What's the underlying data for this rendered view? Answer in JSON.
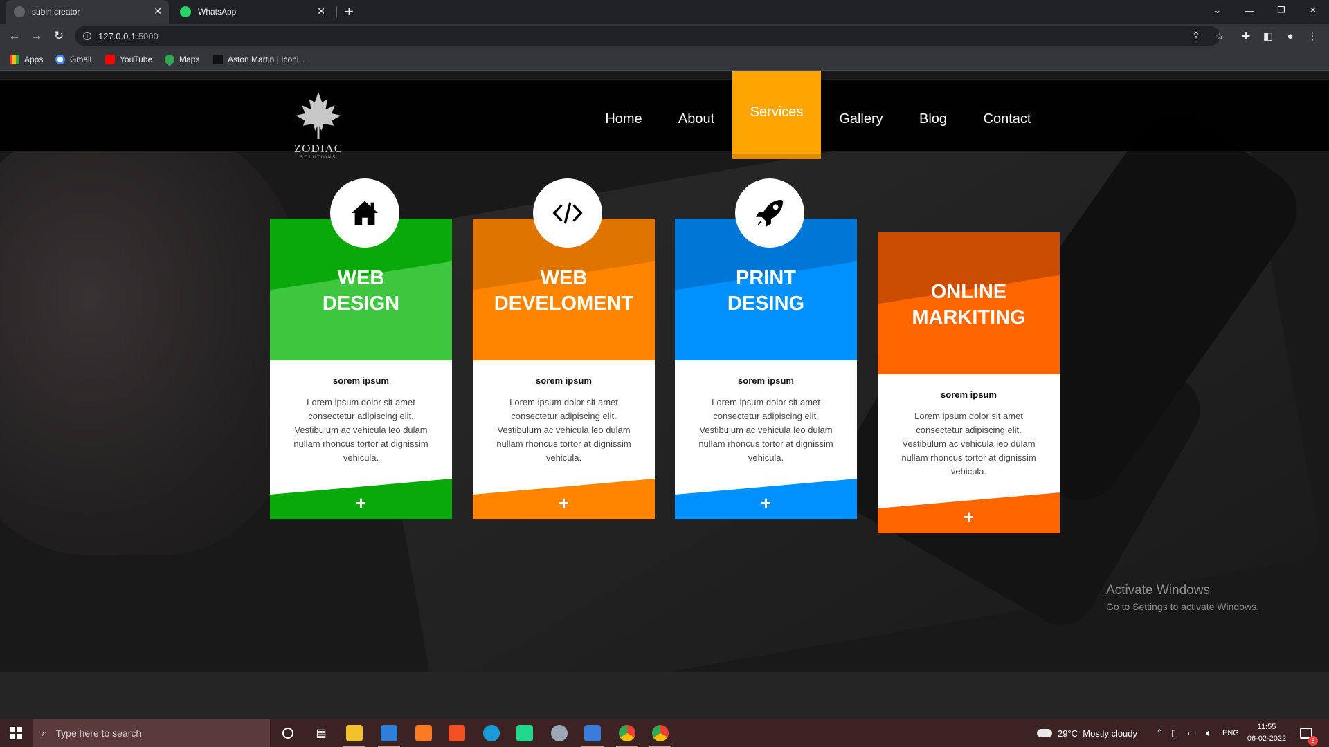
{
  "browser": {
    "tabs": [
      {
        "title": "subin creator",
        "active": true
      },
      {
        "title": "WhatsApp",
        "active": false
      }
    ],
    "url_host": "127.0.0.1",
    "url_port": ":5000",
    "bookmarks": [
      {
        "label": "Apps",
        "icon": "apps-grid-icon"
      },
      {
        "label": "Gmail",
        "icon": "google-icon"
      },
      {
        "label": "YouTube",
        "icon": "youtube-icon"
      },
      {
        "label": "Maps",
        "icon": "maps-pin-icon"
      },
      {
        "label": "Aston Martin | Iconi...",
        "icon": "aston-martin-icon"
      }
    ]
  },
  "site": {
    "logo": {
      "name": "ZODIAC",
      "sub": "SOLUTIONS"
    },
    "nav": [
      {
        "label": "Home",
        "active": false
      },
      {
        "label": "About",
        "active": false
      },
      {
        "label": "Services",
        "active": true
      },
      {
        "label": "Gallery",
        "active": false
      },
      {
        "label": "Blog",
        "active": false
      },
      {
        "label": "Contact",
        "active": false
      }
    ],
    "cards": [
      {
        "title1": "WEB",
        "title2": "DESIGN",
        "subtitle": "sorem ipsum",
        "description": "Lorem ipsum dolor sit amet consectetur adipiscing elit. Vestibulum ac vehicula leo dulam nullam rhoncus tortor at dignissim vehicula.",
        "plus": "+",
        "icon": "home-icon",
        "color": "#0aa90a",
        "color_light": "#3fc63f"
      },
      {
        "title1": "WEB",
        "title2": "DEVELOMENT",
        "subtitle": "sorem ipsum",
        "description": "Lorem ipsum dolor sit amet consectetur adipiscing elit. Vestibulum ac vehicula leo dulam nullam rhoncus tortor at dignissim vehicula.",
        "plus": "+",
        "icon": "code-icon",
        "color": "#e07400",
        "color_light": "#ff8500"
      },
      {
        "title1": "PRINT",
        "title2": "DESING",
        "subtitle": "sorem ipsum",
        "description": "Lorem ipsum dolor sit amet consectetur adipiscing elit. Vestibulum ac vehicula leo dulam nullam rhoncus tortor at dignissim vehicula.",
        "plus": "+",
        "icon": "rocket-icon",
        "color": "#0077d4",
        "color_light": "#0090ff"
      },
      {
        "title1": "ONLINE",
        "title2": "MARKITING",
        "subtitle": "sorem ipsum",
        "description": "Lorem ipsum dolor sit amet consectetur adipiscing elit. Vestibulum ac vehicula leo dulam nullam rhoncus tortor at dignissim vehicula.",
        "plus": "+",
        "icon": "none",
        "color": "#d95200",
        "color_light": "#ff6600"
      }
    ]
  },
  "watermark": {
    "line1": "Activate Windows",
    "line2": "Go to Settings to activate Windows."
  },
  "taskbar": {
    "search_placeholder": "Type here to search",
    "weather": "29°C  Mostly cloudy",
    "language": "ENG",
    "time": "11:55",
    "date": "06-02-2022",
    "notification_count": "8"
  },
  "colors": {
    "accent": "#ffa500",
    "nav_bg": "#000000",
    "taskbar_bg": "#3c2323"
  }
}
